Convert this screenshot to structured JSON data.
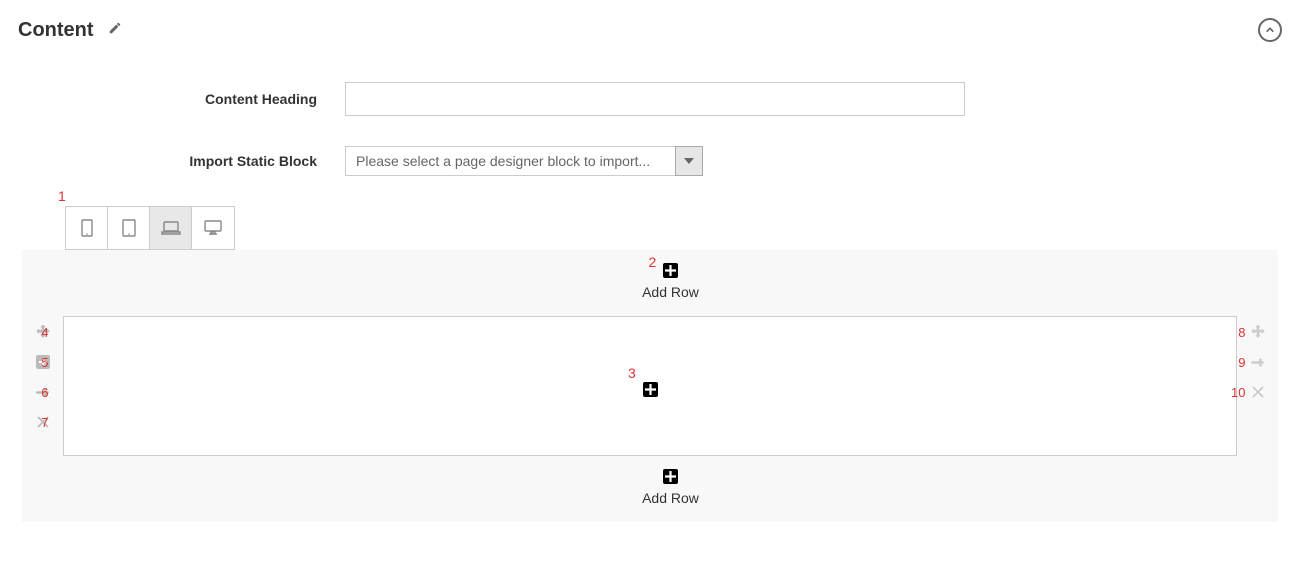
{
  "section": {
    "title": "Content"
  },
  "form": {
    "contentHeading": {
      "label": "Content Heading",
      "value": ""
    },
    "importStaticBlock": {
      "label": "Import Static Block",
      "placeholder": "Please select a page designer block to import..."
    }
  },
  "editor": {
    "addRowLabel": "Add Row"
  },
  "annotations": {
    "a1": "1",
    "a2": "2",
    "a3": "3",
    "a4": "4",
    "a5": "5",
    "a6": "6",
    "a7": "7",
    "a8": "8",
    "a9": "9",
    "a10": "10"
  }
}
